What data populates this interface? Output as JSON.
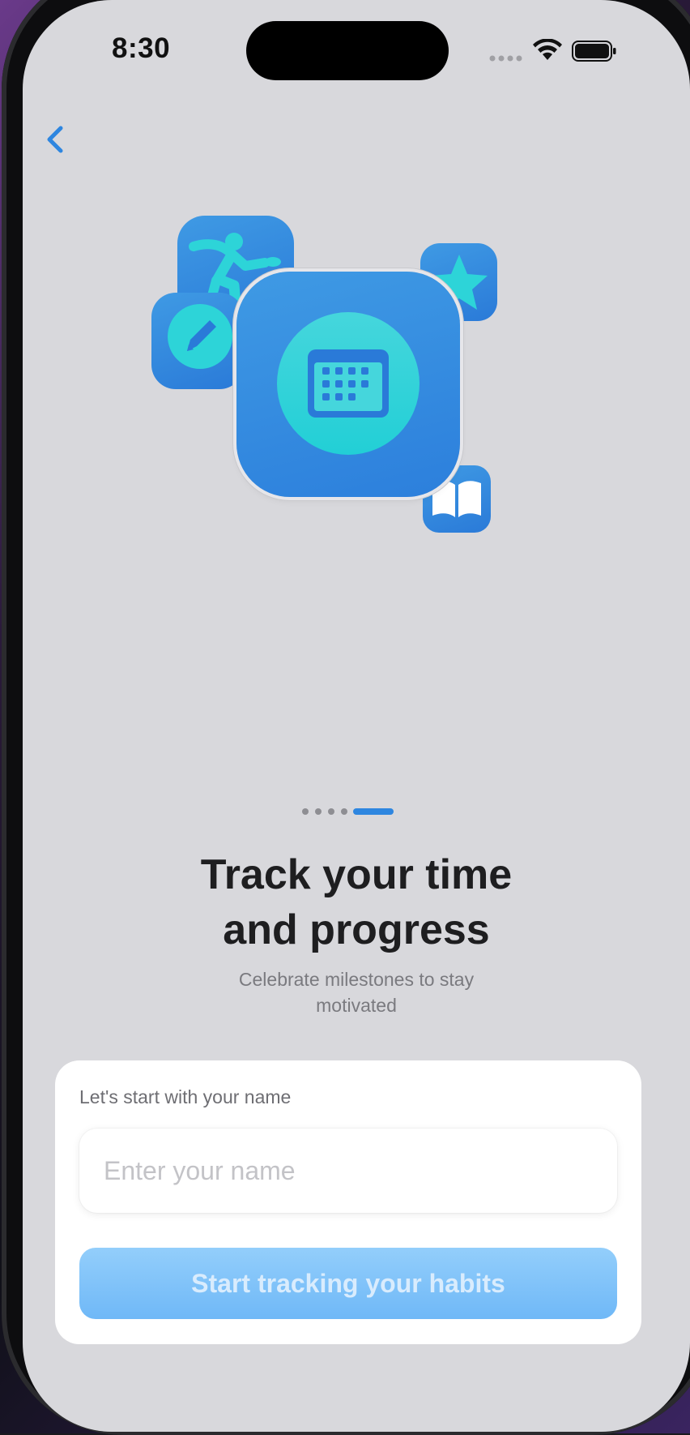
{
  "status_bar": {
    "time": "8:30"
  },
  "nav": {
    "back_icon": "chevron-left-icon"
  },
  "hero": {
    "icons": [
      "running-icon",
      "pencil-icon",
      "star-icon",
      "calendar-icon",
      "book-icon"
    ]
  },
  "pager": {
    "total": 5,
    "active_index": 4
  },
  "onboarding": {
    "title_line1": "Track your time",
    "title_line2": "and progress",
    "subtitle_line1": "Celebrate milestones to stay",
    "subtitle_line2": "motivated"
  },
  "form": {
    "label": "Let's start with your name",
    "name_placeholder": "Enter your name",
    "name_value": "",
    "submit_label": "Start tracking your habits"
  },
  "colors": {
    "accent": "#2E86E0",
    "tile_blue": "#3F9AE4",
    "teal": "#2DD4D8",
    "button_disabled": "#7FC1F9",
    "background": "#D8D8DC"
  }
}
